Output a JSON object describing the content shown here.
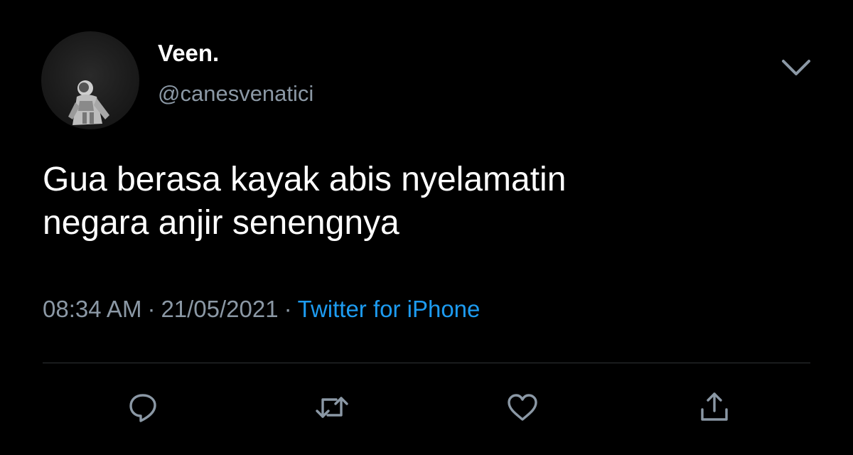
{
  "tweet": {
    "display_name": "Veen.",
    "handle": "@canesvenatici",
    "text_lines": [
      "Gua berasa kayak abis nyelamatin",
      "negara anjir senengnya"
    ],
    "time": "08:34 AM",
    "date": "21/05/2021",
    "separator": "·",
    "source": "Twitter for iPhone"
  },
  "icons": {
    "menu": "chevron-down-icon",
    "reply": "reply-icon",
    "retweet": "retweet-icon",
    "like": "heart-icon",
    "share": "share-icon"
  },
  "colors": {
    "background": "#000000",
    "primary_text": "#ffffff",
    "secondary_text": "#8b98a5",
    "link": "#1d9bf0",
    "divider": "#2f3336"
  }
}
